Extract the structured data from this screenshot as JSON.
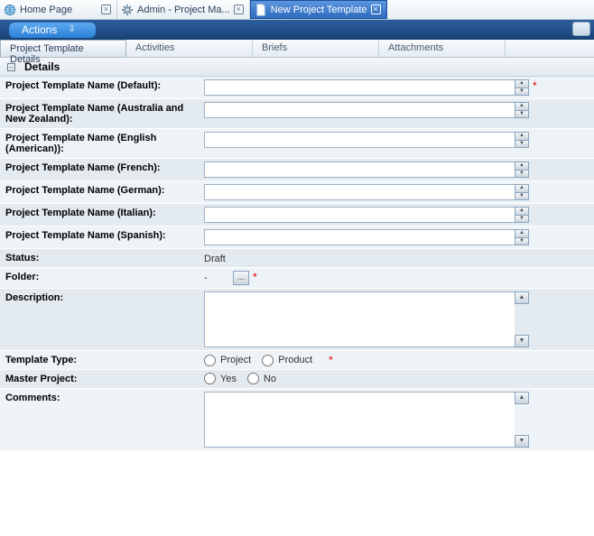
{
  "topTabs": [
    {
      "label": "Home Page",
      "icon": "globe"
    },
    {
      "label": "Admin - Project Ma...",
      "icon": "gear"
    },
    {
      "label": "New Project Template",
      "icon": "doc",
      "active": true
    }
  ],
  "actionsBar": {
    "label": "Actions"
  },
  "subTabs": [
    {
      "label": "Project Template Details",
      "active": true
    },
    {
      "label": "Activities"
    },
    {
      "label": "Briefs"
    },
    {
      "label": "Attachments"
    }
  ],
  "section": {
    "title": "Details"
  },
  "fields": {
    "nameDefault": {
      "label": "Project Template Name (Default):",
      "value": "",
      "required": true
    },
    "nameAUNZ": {
      "label": "Project Template Name (Australia and New Zealand):",
      "value": ""
    },
    "nameEnglishUS": {
      "label": "Project Template Name (English (American)):",
      "value": ""
    },
    "nameFrench": {
      "label": "Project Template Name (French):",
      "value": ""
    },
    "nameGerman": {
      "label": "Project Template Name (German):",
      "value": ""
    },
    "nameItalian": {
      "label": "Project Template Name (Italian):",
      "value": ""
    },
    "nameSpanish": {
      "label": "Project Template Name (Spanish):",
      "value": ""
    },
    "status": {
      "label": "Status:",
      "value": "Draft"
    },
    "folder": {
      "label": "Folder:",
      "value": "-",
      "required": true
    },
    "description": {
      "label": "Description:",
      "value": ""
    },
    "templateType": {
      "label": "Template Type:",
      "options": [
        "Project",
        "Product"
      ],
      "required": true
    },
    "masterProject": {
      "label": "Master Project:",
      "options": [
        "Yes",
        "No"
      ]
    },
    "comments": {
      "label": "Comments:",
      "value": ""
    }
  }
}
